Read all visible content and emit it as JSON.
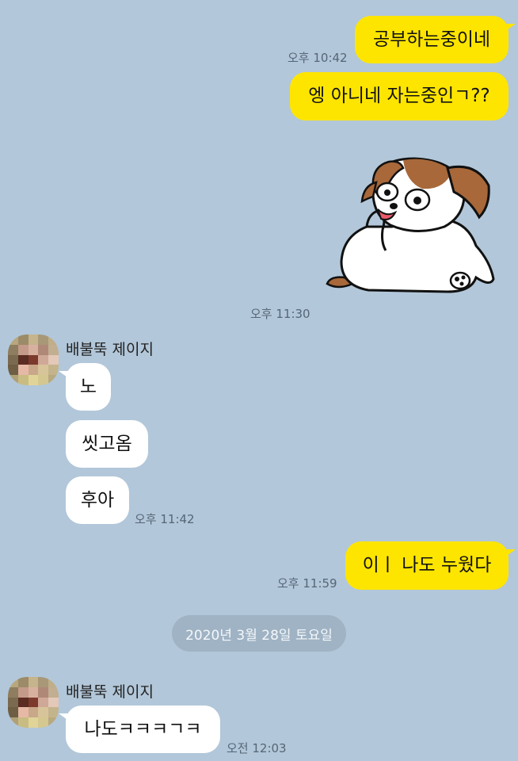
{
  "colors": {
    "background": "#b2c7d9",
    "my_bubble": "#fee500",
    "their_bubble": "#ffffff"
  },
  "messages": {
    "m1": {
      "text": "공부하는중이네",
      "time": "오후 10:42"
    },
    "m2": {
      "text": "엥 아니네 자는중인ㄱ??"
    },
    "sticker": {
      "icon": "puppy-sticker-icon",
      "time": "오후 11:30"
    },
    "group1": {
      "sender": "배불뚝 제이지",
      "texts": [
        "노",
        "씻고옴",
        "후아"
      ],
      "time": "오후 11:42"
    },
    "m6": {
      "text": "이ㅣ 나도 누웠다",
      "time": "오후 11:59"
    },
    "date_divider": "2020년 3월 28일 토요일",
    "group2": {
      "sender": "배불뚝 제이지",
      "texts": [
        "나도ㅋㅋㅋㄱㅋ"
      ],
      "time": "오전 12:03"
    }
  }
}
